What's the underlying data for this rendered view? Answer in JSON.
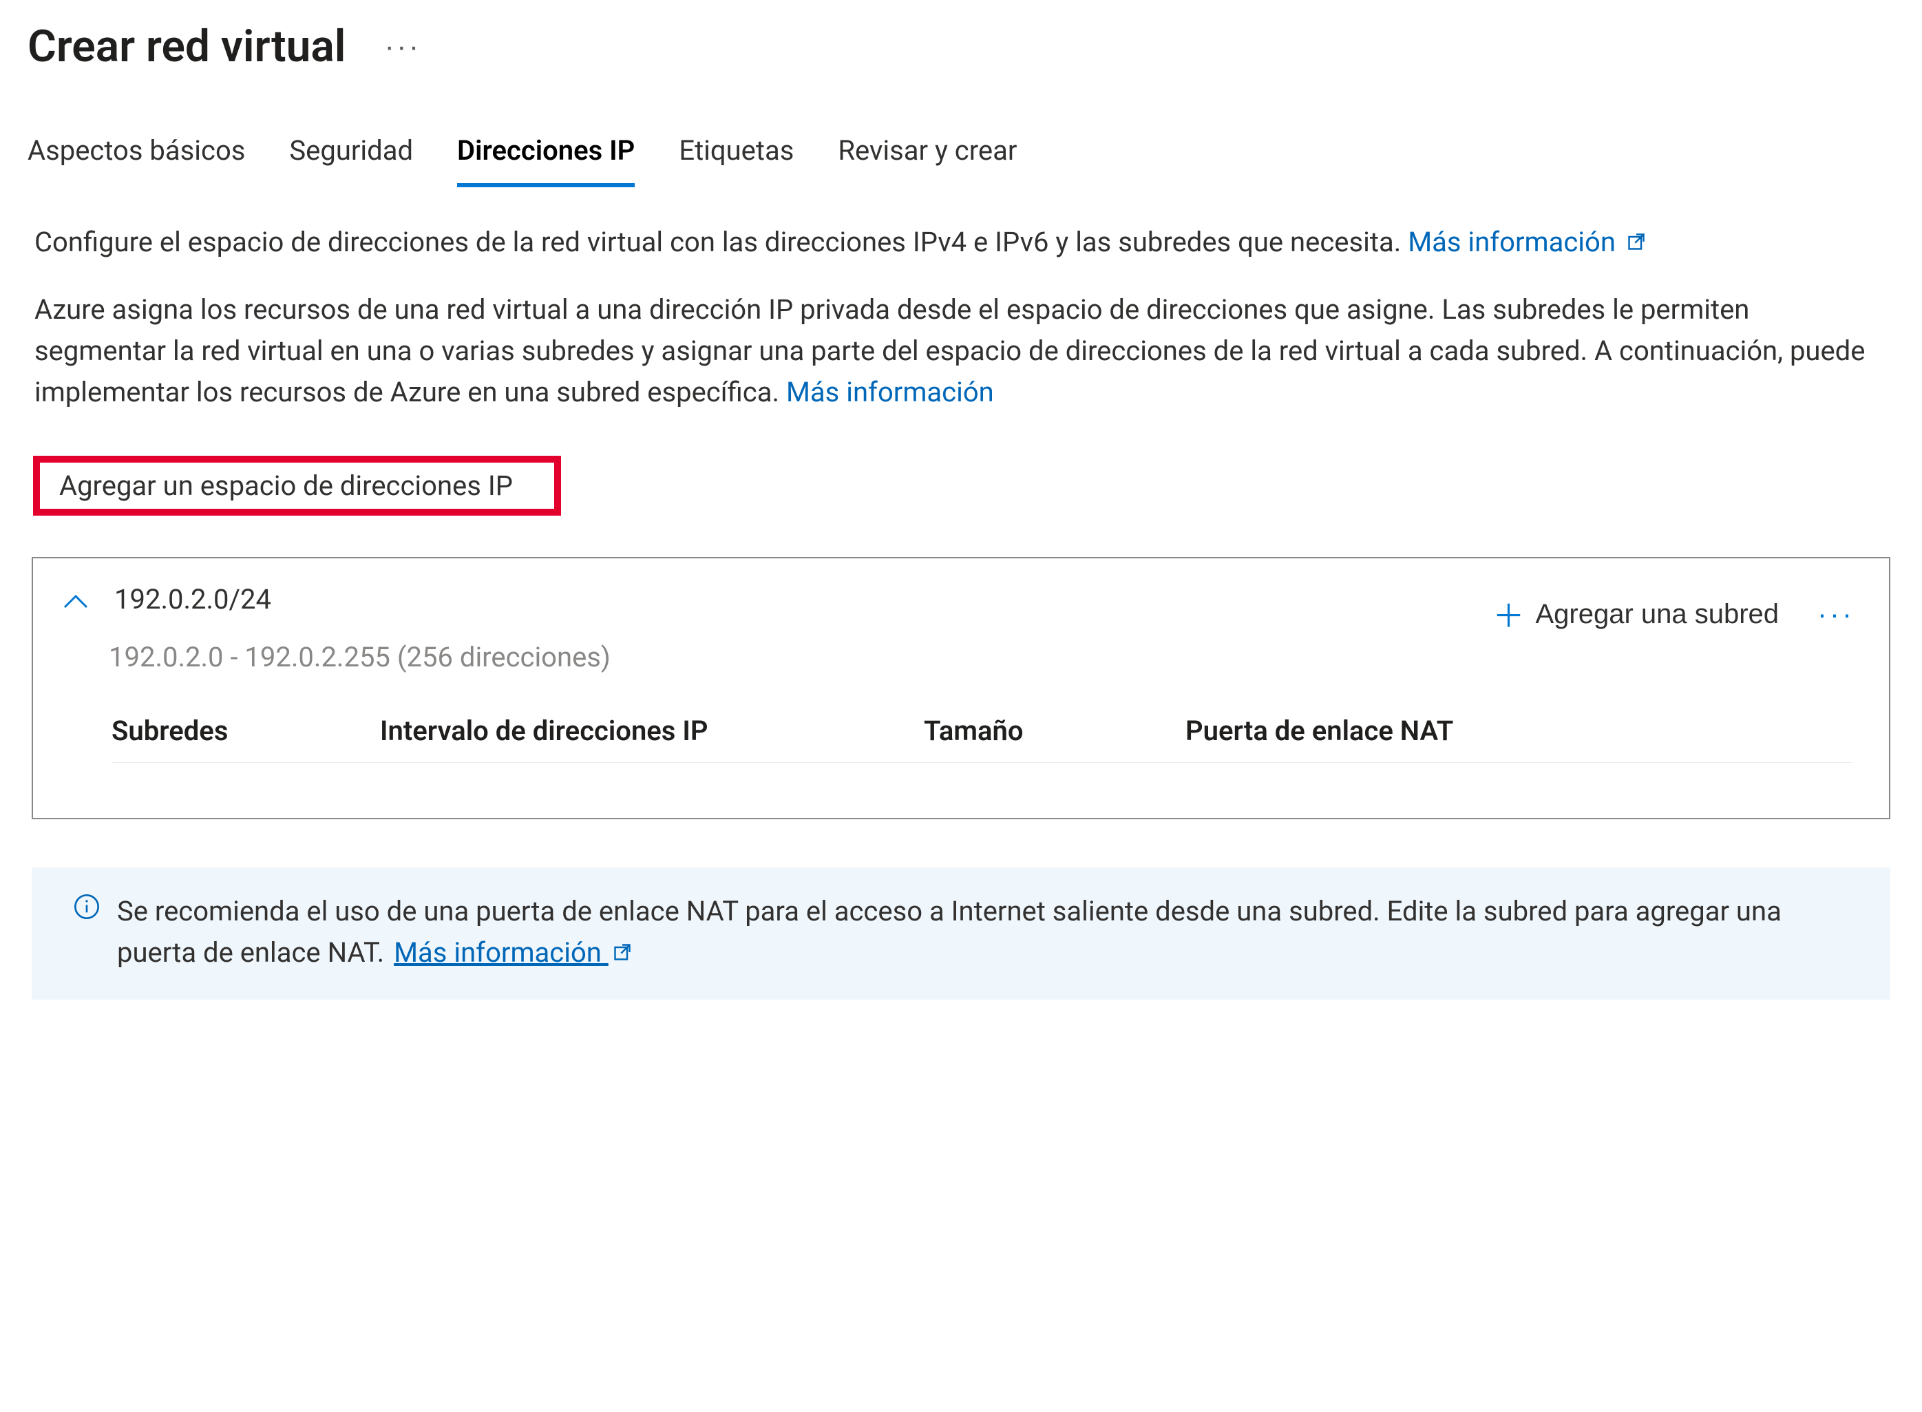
{
  "header": {
    "title": "Crear red virtual"
  },
  "tabs": {
    "items": [
      {
        "label": "Aspectos básicos",
        "active": false
      },
      {
        "label": "Seguridad",
        "active": false
      },
      {
        "label": "Direcciones IP",
        "active": true
      },
      {
        "label": "Etiquetas",
        "active": false
      },
      {
        "label": "Revisar y crear",
        "active": false
      }
    ]
  },
  "intro": {
    "p1": "Configure el espacio de direcciones de la red virtual con las direcciones IPv4 e IPv6 y las subredes que necesita.",
    "p1_link": "Más información",
    "p2": "Azure asigna los recursos de una red virtual a una dirección IP privada desde el espacio de direcciones que asigne. Las subredes le permiten segmentar la red virtual en una o varias subredes y asignar una parte del espacio de direcciones de la red virtual a cada subred. A continuación, puede implementar los recursos de Azure en una subred específica.",
    "p2_link": "Más información"
  },
  "actions": {
    "add_ip_space": "Agregar un espacio de direcciones IP"
  },
  "address_space": {
    "cidr": "192.0.2.0/24",
    "range_text": "192.0.2.0 - 192.0.2.255 (256 direcciones)",
    "add_subnet_label": "Agregar una subred",
    "columns": {
      "subnets": "Subredes",
      "ip_range": "Intervalo de direcciones IP",
      "size": "Tamaño",
      "nat_gw": "Puerta de enlace NAT"
    }
  },
  "info": {
    "text": "Se recomienda el uso de una puerta de enlace NAT para el acceso a Internet saliente desde una subred. Edite la subred para agregar una puerta de enlace NAT.",
    "link": "Más información"
  }
}
